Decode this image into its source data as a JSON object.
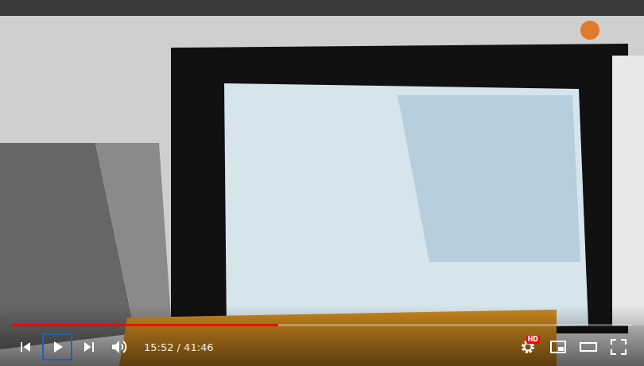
{
  "video": {
    "playing": false
  },
  "progress": {
    "level": 0.43
  },
  "time": "15:52 / 41:46",
  "controls_left": [
    {
      "kind": "previous",
      "focused": false
    },
    {
      "kind": "play",
      "focused": true
    },
    {
      "kind": "next",
      "focused": false
    },
    {
      "kind": "volume",
      "focused": false
    }
  ],
  "controls_right": [
    {
      "kind": "settings",
      "focused": false,
      "badge": "HD"
    },
    {
      "kind": "miniplayer",
      "focused": false
    },
    {
      "kind": "theater",
      "focused": false
    },
    {
      "kind": "fullscreen",
      "focused": false
    }
  ]
}
